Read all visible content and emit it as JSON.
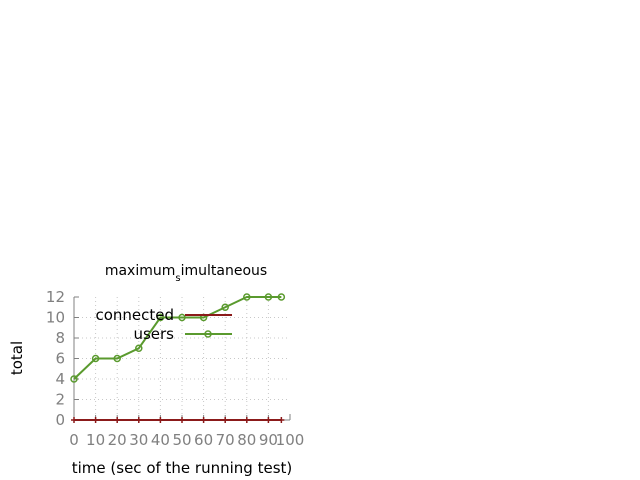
{
  "chart_data": {
    "type": "line",
    "title_main": "maximum",
    "title_sub": "s",
    "title_rest": "imultaneous",
    "xlabel": "time (sec of the running test)",
    "ylabel": "total",
    "xlim": [
      0,
      100
    ],
    "ylim": [
      0,
      12
    ],
    "xticks": [
      0,
      10,
      20,
      30,
      40,
      50,
      60,
      70,
      80,
      90,
      100
    ],
    "yticks": [
      0,
      2,
      4,
      6,
      8,
      10,
      12
    ],
    "grid": true,
    "legend_position": "top-left inside",
    "series": [
      {
        "name": "connected",
        "color": "#8b1a1a",
        "marker": "plus",
        "x": [
          0,
          10,
          20,
          30,
          40,
          50,
          60,
          70,
          80,
          90,
          96
        ],
        "y": [
          0,
          0,
          0,
          0,
          0,
          0,
          0,
          0,
          0,
          0,
          0
        ]
      },
      {
        "name": "users",
        "color": "#5a9a2e",
        "marker": "circle",
        "x": [
          0,
          10,
          20,
          30,
          40,
          50,
          60,
          70,
          80,
          90,
          96
        ],
        "y": [
          4,
          6,
          6,
          7,
          10,
          10,
          10,
          11,
          12,
          12,
          12
        ]
      }
    ]
  }
}
